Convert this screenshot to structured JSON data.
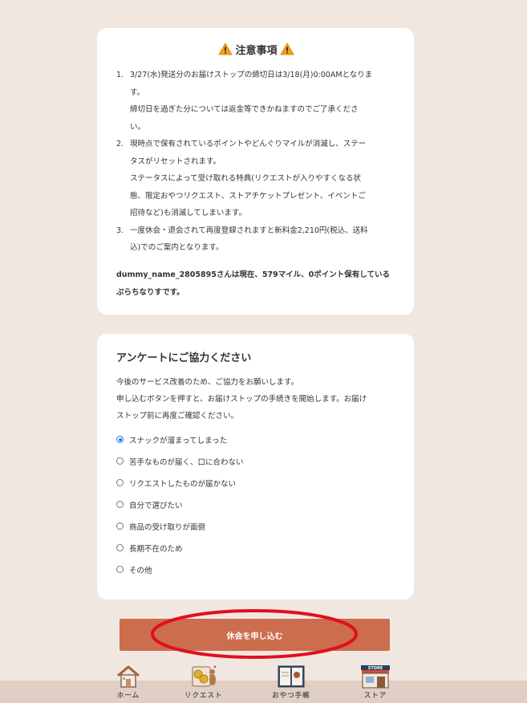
{
  "notice": {
    "title": "注意事項",
    "items": [
      {
        "number": "1.",
        "lines": [
          "3/27(水)発送分のお届けストップの締切日は3/18(月)0:00AMとなりま",
          "す。",
          "締切日を過ぎた分については返金等できかねますのでご了承くださ",
          "い。"
        ]
      },
      {
        "number": "2.",
        "lines": [
          "現時点で保有されているポイントやどんぐりマイルが消滅し、ステー",
          "タスがリセットされます。",
          "ステータスによって受け取れる特典(リクエストが入りやすくなる状",
          "態、限定おやつリクエスト、ストアチケットプレゼント、イベントご",
          "招待など)も消滅してしまいます。"
        ]
      },
      {
        "number": "3.",
        "lines": [
          "一度休会・退会されて再度登録されますと新料金2,210円(税込、送料",
          "込)でのご案内となります。"
        ]
      }
    ],
    "summary_line1": "dummy_name_2805895さんは現在、579マイル、0ポイント保有している",
    "summary_line2": "ぷらちなりすです。"
  },
  "survey": {
    "title": "アンケートにご協力ください",
    "desc_line1": "今後のサービス改善のため、ご協力をお願いします。",
    "desc_line2": "申し込むボタンを押すと、お届けストップの手続きを開始します。お届け",
    "desc_line3": "ストップ前に再度ご確認ください。",
    "selected_index": 0,
    "options": [
      "スナックが溜まってしまった",
      "苦手なものが届く、口に合わない",
      "リクエストしたものが届かない",
      "自分で選びたい",
      "商品の受け取りが面倒",
      "長期不在のため",
      "その他"
    ]
  },
  "submit_label": "休会を申し込む",
  "nav": {
    "home": "ホーム",
    "request": "リクエスト",
    "notebook": "おやつ手帳",
    "store": "ストア",
    "store_sign": "STORE"
  },
  "colors": {
    "background": "#f1e7e1",
    "button": "#cc6d4d",
    "annotation": "#e0101e",
    "radio_selected": "#1a73e8"
  }
}
